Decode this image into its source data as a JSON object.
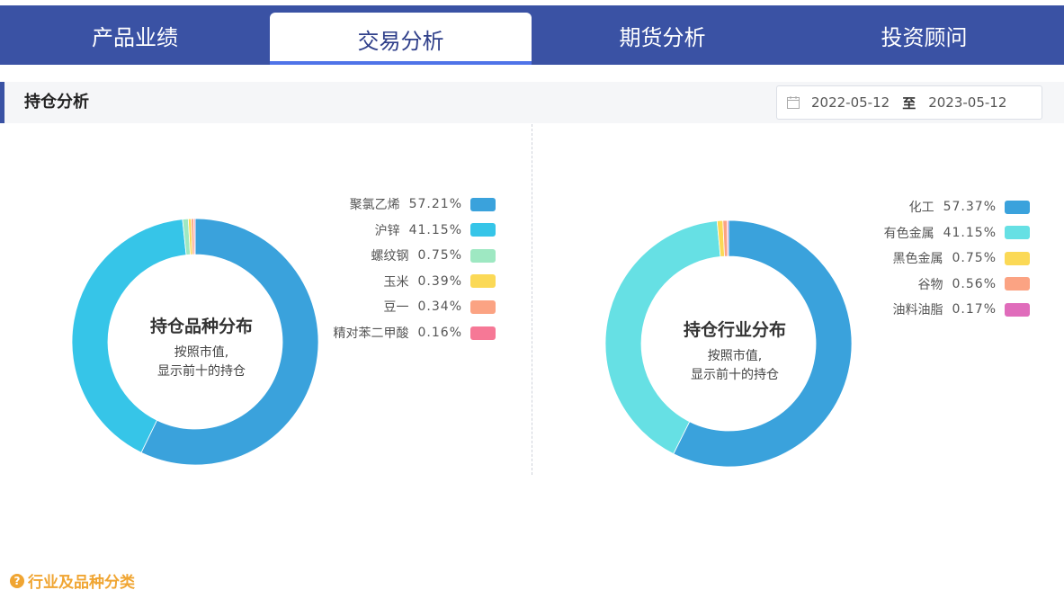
{
  "tabs": [
    {
      "label": "产品业绩"
    },
    {
      "label": "交易分析"
    },
    {
      "label": "期货分析"
    },
    {
      "label": "投资顾问"
    }
  ],
  "active_tab": 1,
  "section": {
    "title": "持仓分析"
  },
  "date_range": {
    "start": "2022-05-12",
    "separator": "至",
    "end": "2023-05-12"
  },
  "chart_data": [
    {
      "type": "pie",
      "title": "持仓品种分布",
      "subtitle_line1": "按照市值,",
      "subtitle_line2": "显示前十的持仓",
      "labels": [
        "聚氯乙烯",
        "沪锌",
        "螺纹钢",
        "玉米",
        "豆一",
        "精对苯二甲酸"
      ],
      "values": [
        57.21,
        41.15,
        0.75,
        0.39,
        0.34,
        0.16
      ],
      "value_labels": [
        "57.21%",
        "41.15%",
        "0.75%",
        "0.39%",
        "0.34%",
        "0.16%"
      ],
      "colors": [
        "#3aa2dc",
        "#36c5e8",
        "#9ee8c2",
        "#fbd956",
        "#fba383",
        "#f67896"
      ],
      "legend_position": "top-right"
    },
    {
      "type": "pie",
      "title": "持仓行业分布",
      "subtitle_line1": "按照市值,",
      "subtitle_line2": "显示前十的持仓",
      "labels": [
        "化工",
        "有色金属",
        "黑色金属",
        "谷物",
        "油料油脂"
      ],
      "values": [
        57.37,
        41.15,
        0.75,
        0.56,
        0.17
      ],
      "value_labels": [
        "57.37%",
        "41.15%",
        "0.75%",
        "0.56%",
        "0.17%"
      ],
      "colors": [
        "#3aa2dc",
        "#66e0e4",
        "#fbd956",
        "#fba383",
        "#e06cbb"
      ],
      "legend_position": "top-right"
    }
  ],
  "footer": {
    "icon": "question-circle-icon",
    "label": "行业及品种分类"
  }
}
